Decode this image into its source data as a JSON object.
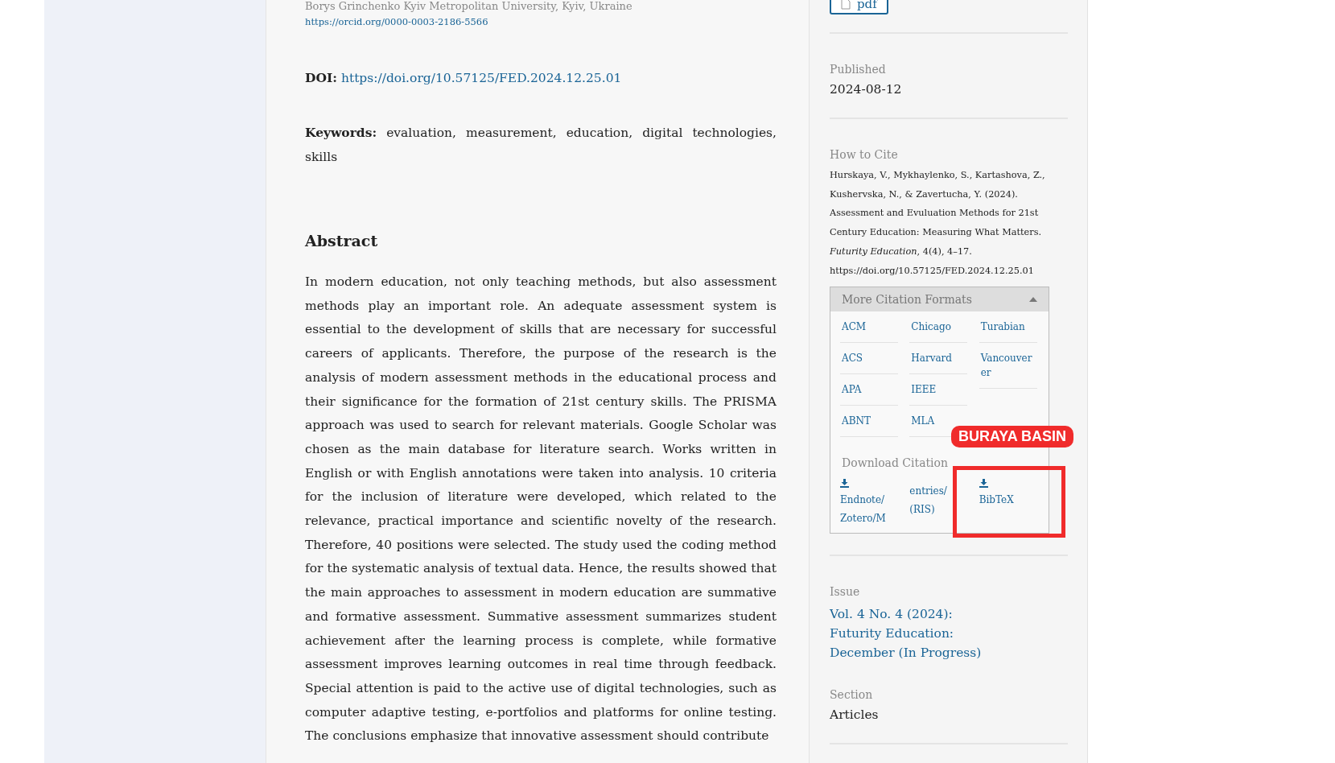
{
  "article": {
    "affiliation": "Borys Grinchenko Kyiv Metropolitan University, Kyiv, Ukraine",
    "orcid": "https://orcid.org/0000-0003-2186-5566",
    "doi_label": "DOI:",
    "doi": "https://doi.org/10.57125/FED.2024.12.25.01",
    "keywords_label": "Keywords:",
    "keywords": "evaluation, measurement, education, digital technologies, skills",
    "abstract_title": "Abstract",
    "abstract": "In modern education, not only teaching methods, but also assessment methods play an important role. An adequate assessment system is essential to the development of skills that are necessary for successful careers of applicants. Therefore, the purpose of the research is the analysis of modern assessment methods in the educational process and their significance for the formation of 21st century skills. The PRISMA approach was used to search for relevant materials. Google Scholar was chosen as the main database for literature search. Works written in English or with English annotations were taken into analysis. 10 criteria for the inclusion of literature were developed, which related to the relevance, practical importance and scientific novelty of the research. Therefore, 40 positions were selected. The study used the coding method for the systematic analysis of textual data. Hence, the results showed that the main approaches to assessment in modern education are summative and formative assessment. Summative assessment summarizes student achievement after the learning process is complete, while formative assessment improves learning outcomes in real time through feedback. Special attention is paid to the active use of digital technologies, such as computer adaptive testing, e-portfolios and platforms for online testing. The conclusions emphasize that innovative assessment should contribute"
  },
  "sidebar": {
    "pdf_button": "pdf",
    "published_label": "Published",
    "published": "2024-08-12",
    "cite_label": "How to Cite",
    "citation": "Hurskaya, V., Mykhaylenko, S., Kartashova, Z., Kushervska, N., & Zavertucha, Y. (2024). Assessment and Evuluation Methods for 21st Century Education: Measuring What Matters. *Futurity Education*, 4(4), 4–17. https://doi.org/10.57125/FED.2024.12.25.01",
    "formats": {
      "title": "More Citation Formats",
      "expanded": true,
      "columns": [
        [
          "ACM",
          "ACS",
          "APA",
          "ABNT"
        ],
        [
          "Chicago",
          "Harvard",
          "IEEE",
          "MLA"
        ],
        [
          "Turabian",
          "Vancouver er"
        ]
      ],
      "download_label": "Download Citation",
      "downloads": [
        {
          "label": "Endnote/ Zotero/M",
          "icon": true
        },
        {
          "label": "entries/ (RIS)",
          "icon": false
        },
        {
          "label": "BibTeX",
          "icon": true
        }
      ]
    },
    "issue_label": "Issue",
    "issue": "Vol. 4 No. 4 (2024): Futurity Education: December (In Progress)",
    "section_label": "Section",
    "section": "Articles"
  },
  "annotation": {
    "label": "BURAYA BASIN"
  }
}
